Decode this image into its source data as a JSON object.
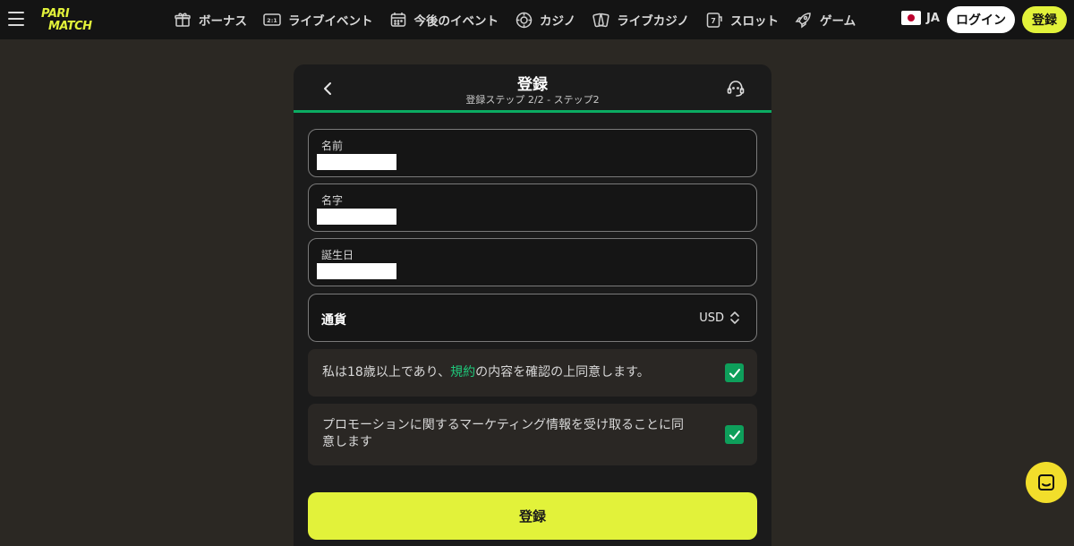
{
  "brand": {
    "line1": "PARI",
    "line2": "MATCH",
    "color": "#e2f23a"
  },
  "nav": {
    "items": [
      {
        "label": "ボーナス",
        "icon": "gift-icon"
      },
      {
        "label": "ライブイベント",
        "icon": "scoreboard-icon"
      },
      {
        "label": "今後のイベント",
        "icon": "calendar-icon"
      },
      {
        "label": "カジノ",
        "icon": "casino-chip-icon"
      },
      {
        "label": "ライブカジノ",
        "icon": "cards-icon"
      },
      {
        "label": "スロット",
        "icon": "slot-icon"
      },
      {
        "label": "ゲーム",
        "icon": "rocket-icon"
      }
    ],
    "lang": "JA",
    "login_label": "ログイン",
    "register_label": "登録"
  },
  "modal": {
    "title": "登録",
    "subtitle": "登録ステップ 2/2 - ステップ2",
    "fields": [
      {
        "label": "名前",
        "value": ""
      },
      {
        "label": "名字",
        "value": ""
      },
      {
        "label": "誕生日",
        "value": ""
      }
    ],
    "currency": {
      "label": "通貨",
      "value": "USD"
    },
    "terms": {
      "before": "私は18歳以上であり、",
      "link": "規約",
      "after": "の内容を確認の上同意します。",
      "checked": true
    },
    "marketing": {
      "line1": "プロモーションに関するマーケティング情報を受け取ることに同",
      "line2": "意します",
      "checked": true
    },
    "submit_label": "登録"
  },
  "colors": {
    "accent": "#e2f23a",
    "progress": "#0bab62",
    "checkbox": "#0e9f5b",
    "link": "#1fc77a",
    "chat": "#f2de2b"
  }
}
